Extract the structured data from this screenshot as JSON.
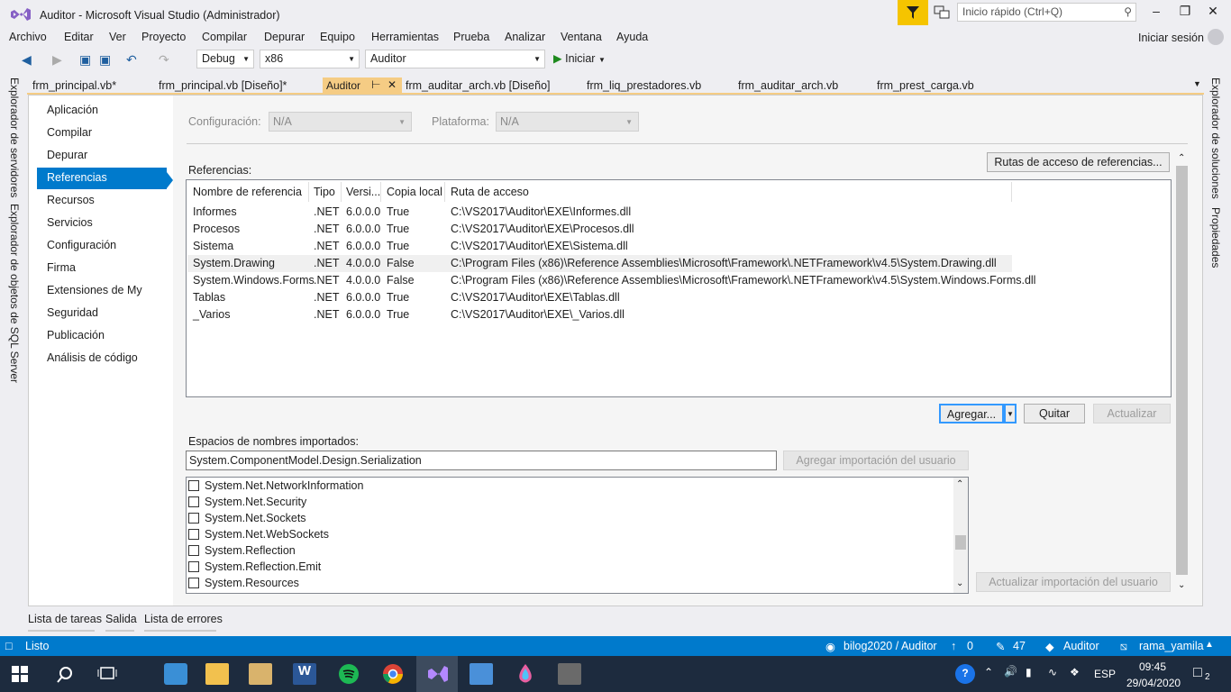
{
  "window": {
    "title": "Auditor - Microsoft Visual Studio  (Administrador)"
  },
  "quick_launch": {
    "placeholder": "Inicio rápido (Ctrl+Q)"
  },
  "menu": [
    "Archivo",
    "Editar",
    "Ver",
    "Proyecto",
    "Compilar",
    "Depurar",
    "Equipo",
    "Herramientas",
    "Prueba",
    "Analizar",
    "Ventana",
    "Ayuda"
  ],
  "signin": "Iniciar sesión",
  "toolbar": {
    "config": "Debug",
    "platform": "x86",
    "project": "Auditor",
    "start": "Iniciar"
  },
  "left_panels": [
    "Explorador de servidores",
    "Explorador de objetos de SQL Server"
  ],
  "right_panels": [
    "Explorador de soluciones",
    "Propiedades"
  ],
  "tabs": [
    "frm_principal.vb*",
    "frm_principal.vb [Diseño]*",
    "Auditor",
    "frm_auditar_arch.vb [Diseño]",
    "frm_liq_prestadores.vb",
    "frm_auditar_arch.vb",
    "frm_prest_carga.vb"
  ],
  "nav": [
    "Aplicación",
    "Compilar",
    "Depurar",
    "Referencias",
    "Recursos",
    "Servicios",
    "Configuración",
    "Firma",
    "Extensiones de My",
    "Seguridad",
    "Publicación",
    "Análisis de código"
  ],
  "nav_selected": "Referencias",
  "config_label": "Configuración:",
  "config_value": "N/A",
  "platform_label": "Plataforma:",
  "platform_value": "N/A",
  "ref_paths_button": "Rutas de acceso de referencias...",
  "references_label": "Referencias:",
  "ref_columns": [
    "Nombre de referencia",
    "Tipo",
    "Versi...",
    "Copia local",
    "Ruta de acceso"
  ],
  "references": [
    {
      "name": "Informes",
      "type": ".NET",
      "version": "6.0.0.0",
      "copy": "True",
      "path": "C:\\VS2017\\Auditor\\EXE\\Informes.dll"
    },
    {
      "name": "Procesos",
      "type": ".NET",
      "version": "6.0.0.0",
      "copy": "True",
      "path": "C:\\VS2017\\Auditor\\EXE\\Procesos.dll"
    },
    {
      "name": "Sistema",
      "type": ".NET",
      "version": "6.0.0.0",
      "copy": "True",
      "path": "C:\\VS2017\\Auditor\\EXE\\Sistema.dll"
    },
    {
      "name": "System.Drawing",
      "type": ".NET",
      "version": "4.0.0.0",
      "copy": "False",
      "path": "C:\\Program Files (x86)\\Reference Assemblies\\Microsoft\\Framework\\.NETFramework\\v4.5\\System.Drawing.dll"
    },
    {
      "name": "System.Windows.Forms",
      "type": ".NET",
      "version": "4.0.0.0",
      "copy": "False",
      "path": "C:\\Program Files (x86)\\Reference Assemblies\\Microsoft\\Framework\\.NETFramework\\v4.5\\System.Windows.Forms.dll"
    },
    {
      "name": "Tablas",
      "type": ".NET",
      "version": "6.0.0.0",
      "copy": "True",
      "path": "C:\\VS2017\\Auditor\\EXE\\Tablas.dll"
    },
    {
      "name": "_Varios",
      "type": ".NET",
      "version": "6.0.0.0",
      "copy": "True",
      "path": "C:\\VS2017\\Auditor\\EXE\\_Varios.dll"
    }
  ],
  "buttons": {
    "add": "Agregar...",
    "remove": "Quitar",
    "update": "Actualizar",
    "add_import": "Agregar importación del usuario",
    "update_import": "Actualizar importación del usuario"
  },
  "namespaces_label": "Espacios de nombres importados:",
  "namespace_input": "System.ComponentModel.Design.Serialization",
  "namespaces": [
    "System.Net.NetworkInformation",
    "System.Net.Security",
    "System.Net.Sockets",
    "System.Net.WebSockets",
    "System.Reflection",
    "System.Reflection.Emit",
    "System.Resources"
  ],
  "bottom_tabs": [
    "Lista de tareas",
    "Salida",
    "Lista de errores"
  ],
  "status": {
    "ready": "Listo",
    "repo": "bilog2020 / Auditor",
    "push": "0",
    "edits": "47",
    "project": "Auditor",
    "branch": "rama_yamila"
  },
  "tray": {
    "lang": "ESP",
    "time": "09:45",
    "date": "29/04/2020",
    "notifications": "2"
  },
  "colors": {
    "accent": "#007acc",
    "active_tab": "#f5cc84",
    "taskbar": "#1d2b3e"
  }
}
